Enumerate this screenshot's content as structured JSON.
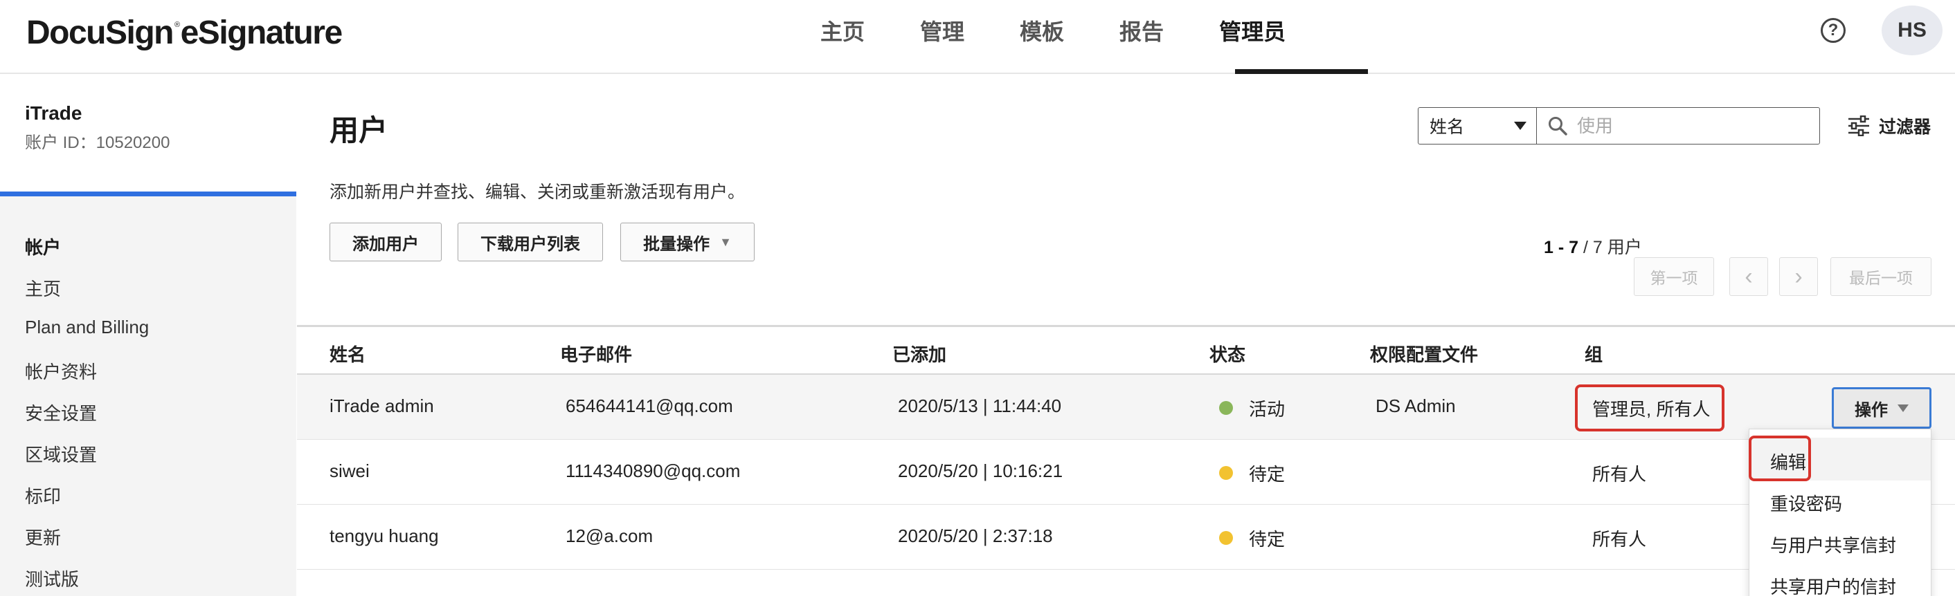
{
  "header": {
    "logo": "DocuSign",
    "logo_mark": "®",
    "logo_suffix": "eSignature",
    "nav": [
      "主页",
      "管理",
      "模板",
      "报告",
      "管理员"
    ],
    "active_nav": "管理员",
    "avatar_initials": "HS",
    "help_glyph": "?"
  },
  "sidebar": {
    "account_name": "iTrade",
    "account_id": "账户 ID：10520200",
    "section_title": "帐户",
    "items": [
      "主页",
      "Plan and Billing",
      "帐户资料",
      "安全设置",
      "区域设置",
      "标印",
      "更新",
      "测试版"
    ]
  },
  "main": {
    "title": "用户",
    "description": "添加新用户并查找、编辑、关闭或重新激活现有用户。",
    "buttons": {
      "add_user": "添加用户",
      "download_list": "下载用户列表",
      "bulk_actions": "批量操作"
    },
    "search": {
      "field_select": "姓名",
      "placeholder": "使用"
    },
    "filter_label": "过滤器",
    "pagination": {
      "range": "1 - 7",
      "total": " / 7 用户",
      "first": "第一项",
      "prev": "‹",
      "next": "›",
      "last": "最后一项"
    }
  },
  "table": {
    "columns": [
      "姓名",
      "电子邮件",
      "已添加",
      "状态",
      "权限配置文件",
      "组"
    ],
    "rows": [
      {
        "name": "iTrade admin",
        "email": "654644141@qq.com",
        "added": "2020/5/13 | 11:44:40",
        "status": "活动",
        "status_color": "#8ab65a",
        "profile": "DS Admin",
        "group": "管理员, 所有人"
      },
      {
        "name": "siwei",
        "email": "1114340890@qq.com",
        "added": "2020/5/20 | 10:16:21",
        "status": "待定",
        "status_color": "#f2c230",
        "profile": "",
        "group": "所有人"
      },
      {
        "name": "tengyu huang",
        "email": "12@a.com",
        "added": "2020/5/20 | 2:37:18",
        "status": "待定",
        "status_color": "#f2c230",
        "profile": "",
        "group": "所有人"
      }
    ],
    "action_button": "操作"
  },
  "action_menu": {
    "items": [
      "编辑",
      "重设密码",
      "与用户共享信封",
      "共享用户的信封"
    ]
  },
  "colors": {
    "accent_blue": "#2f6fe0",
    "highlight_red": "#d7332c"
  }
}
